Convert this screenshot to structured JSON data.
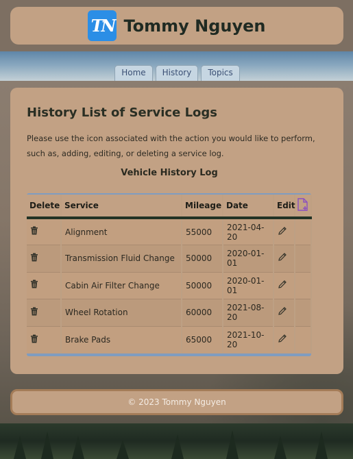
{
  "header": {
    "logo_text": "TN",
    "site_title": "Tommy Nguyen"
  },
  "nav": {
    "tabs": [
      {
        "label": "Home"
      },
      {
        "label": "History"
      },
      {
        "label": "Topics"
      }
    ]
  },
  "main": {
    "title": "History List of Service Logs",
    "intro": "Please use the icon associated with the action you would like to perform, such as, adding, editing, or deleting a service log.",
    "table": {
      "caption": "Vehicle History Log",
      "headers": {
        "delete": "Delete",
        "service": "Service",
        "mileage": "Mileage",
        "date": "Date",
        "edit": "Edit",
        "add_icon": "add-file-icon"
      },
      "rows": [
        {
          "service": "Alignment",
          "mileage": "55000",
          "date": "2021-04-20"
        },
        {
          "service": "Transmission Fluid Change",
          "mileage": "50000",
          "date": "2020-01-01"
        },
        {
          "service": "Cabin Air Filter Change",
          "mileage": "50000",
          "date": "2020-01-01"
        },
        {
          "service": "Wheel Rotation",
          "mileage": "60000",
          "date": "2021-08-20"
        },
        {
          "service": "Brake Pads",
          "mileage": "65000",
          "date": "2021-10-20"
        }
      ]
    }
  },
  "footer": {
    "copyright": "© 2023 Tommy Nguyen"
  },
  "colors": {
    "card": "#c2a184",
    "logo": "#2b8ee6",
    "nav_tab": "#c6d6e2",
    "table_accent": "#7f9cc0",
    "add_icon": "#8a4fc0"
  }
}
